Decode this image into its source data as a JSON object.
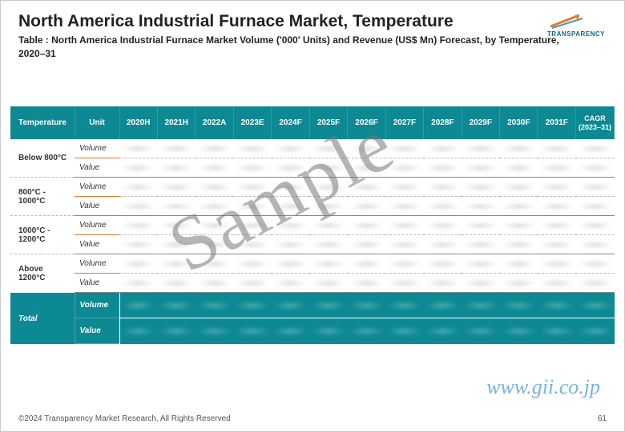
{
  "header": {
    "title": "North America Industrial Furnace Market, Temperature",
    "subtitle": "Table : North America Industrial Furnace Market  Volume ('000' Units) and Revenue (US$ Mn) Forecast, by Temperature, 2020–31",
    "logo_text": "TRANSPARENCY"
  },
  "table": {
    "columns": [
      "Temperature",
      "Unit",
      "2020H",
      "2021H",
      "2022A",
      "2023E",
      "2024F",
      "2025F",
      "2026F",
      "2027F",
      "2028F",
      "2029F",
      "2030F",
      "2031F",
      "CAGR (2023–31)"
    ],
    "rows": [
      {
        "label": "Below 800°C",
        "units": [
          "Volume",
          "Value"
        ]
      },
      {
        "label": "800°C - 1000°C",
        "units": [
          "Volume",
          "Value"
        ]
      },
      {
        "label": "1000°C - 1200°C",
        "units": [
          "Volume",
          "Value"
        ]
      },
      {
        "label": "Above 1200°C",
        "units": [
          "Volume",
          "Value"
        ]
      }
    ],
    "total": {
      "label": "Total",
      "units": [
        "Volume",
        "Value"
      ]
    }
  },
  "footer": {
    "copyright": "©2024 Transparency Market Research, All Rights Reserved",
    "page": "61"
  },
  "watermark": {
    "sample": "Sample",
    "url": "www.gii.co.jp"
  },
  "chart_data": {
    "type": "table",
    "note": "All numeric cell values are obscured/blurred in the source image (sample watermark). No readable data values are present.",
    "row_categories": [
      "Below 800°C",
      "800°C - 1000°C",
      "1000°C - 1200°C",
      "Above 1200°C",
      "Total"
    ],
    "metrics": [
      "Volume ('000' Units)",
      "Value (US$ Mn)"
    ],
    "year_columns": [
      "2020H",
      "2021H",
      "2022A",
      "2023E",
      "2024F",
      "2025F",
      "2026F",
      "2027F",
      "2028F",
      "2029F",
      "2030F",
      "2031F"
    ],
    "extra_column": "CAGR (2023–31)",
    "values": null
  }
}
